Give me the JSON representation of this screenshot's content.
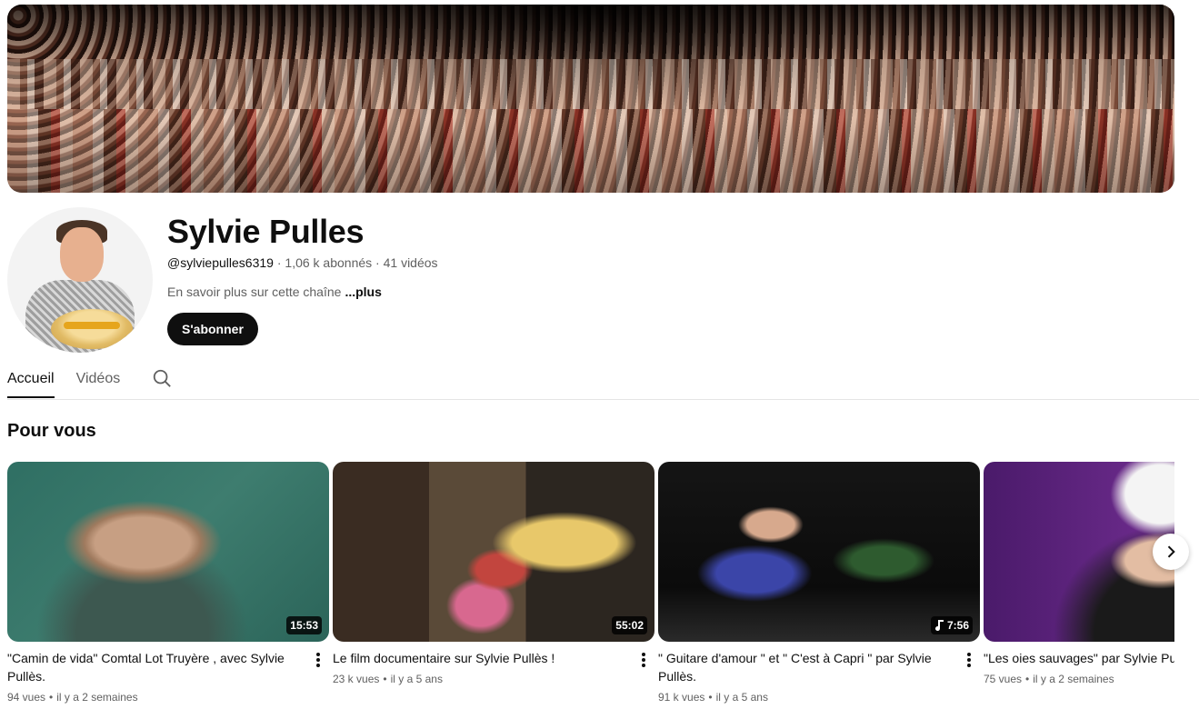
{
  "channel": {
    "name": "Sylvie Pulles",
    "handle": "@sylviepulles6319",
    "subscribers": "1,06 k abonnés",
    "video_count": "41 vidéos",
    "meta_separator": " · ",
    "description": "En savoir plus sur cette chaîne",
    "more_label": "...plus",
    "subscribe_label": "S'abonner"
  },
  "tabs": [
    {
      "label": "Accueil",
      "active": true
    },
    {
      "label": "Vidéos",
      "active": false
    }
  ],
  "icons": {
    "search": "search-icon",
    "more": "more-vert-icon",
    "next": "chevron-right-icon",
    "music": "music-note-icon"
  },
  "section": {
    "title": "Pour vous"
  },
  "videos": [
    {
      "title": "\"Camin de vida\" Comtal Lot Truyère , avec Sylvie Pullès.",
      "duration": "15:53",
      "views": "94 vues",
      "age": "il y a 2 semaines"
    },
    {
      "title": "Le film documentaire sur Sylvie Pullès !",
      "duration": "55:02",
      "views": "23 k vues",
      "age": "il y a 5 ans"
    },
    {
      "title": "\" Guitare d'amour \" et \" C'est à Capri \" par Sylvie Pullès.",
      "duration": "7:56",
      "views": "91 k vues",
      "age": "il y a 5 ans"
    },
    {
      "title": "\"Les oies sauvages\" par Sylvie Pullès",
      "duration": "",
      "views": "75 vues",
      "age": "il y a 2 semaines"
    }
  ],
  "colors": {
    "text_primary": "#0f0f0f",
    "text_secondary": "#606060",
    "button_dark": "#0f0f0f",
    "divider": "#e5e5e5"
  }
}
